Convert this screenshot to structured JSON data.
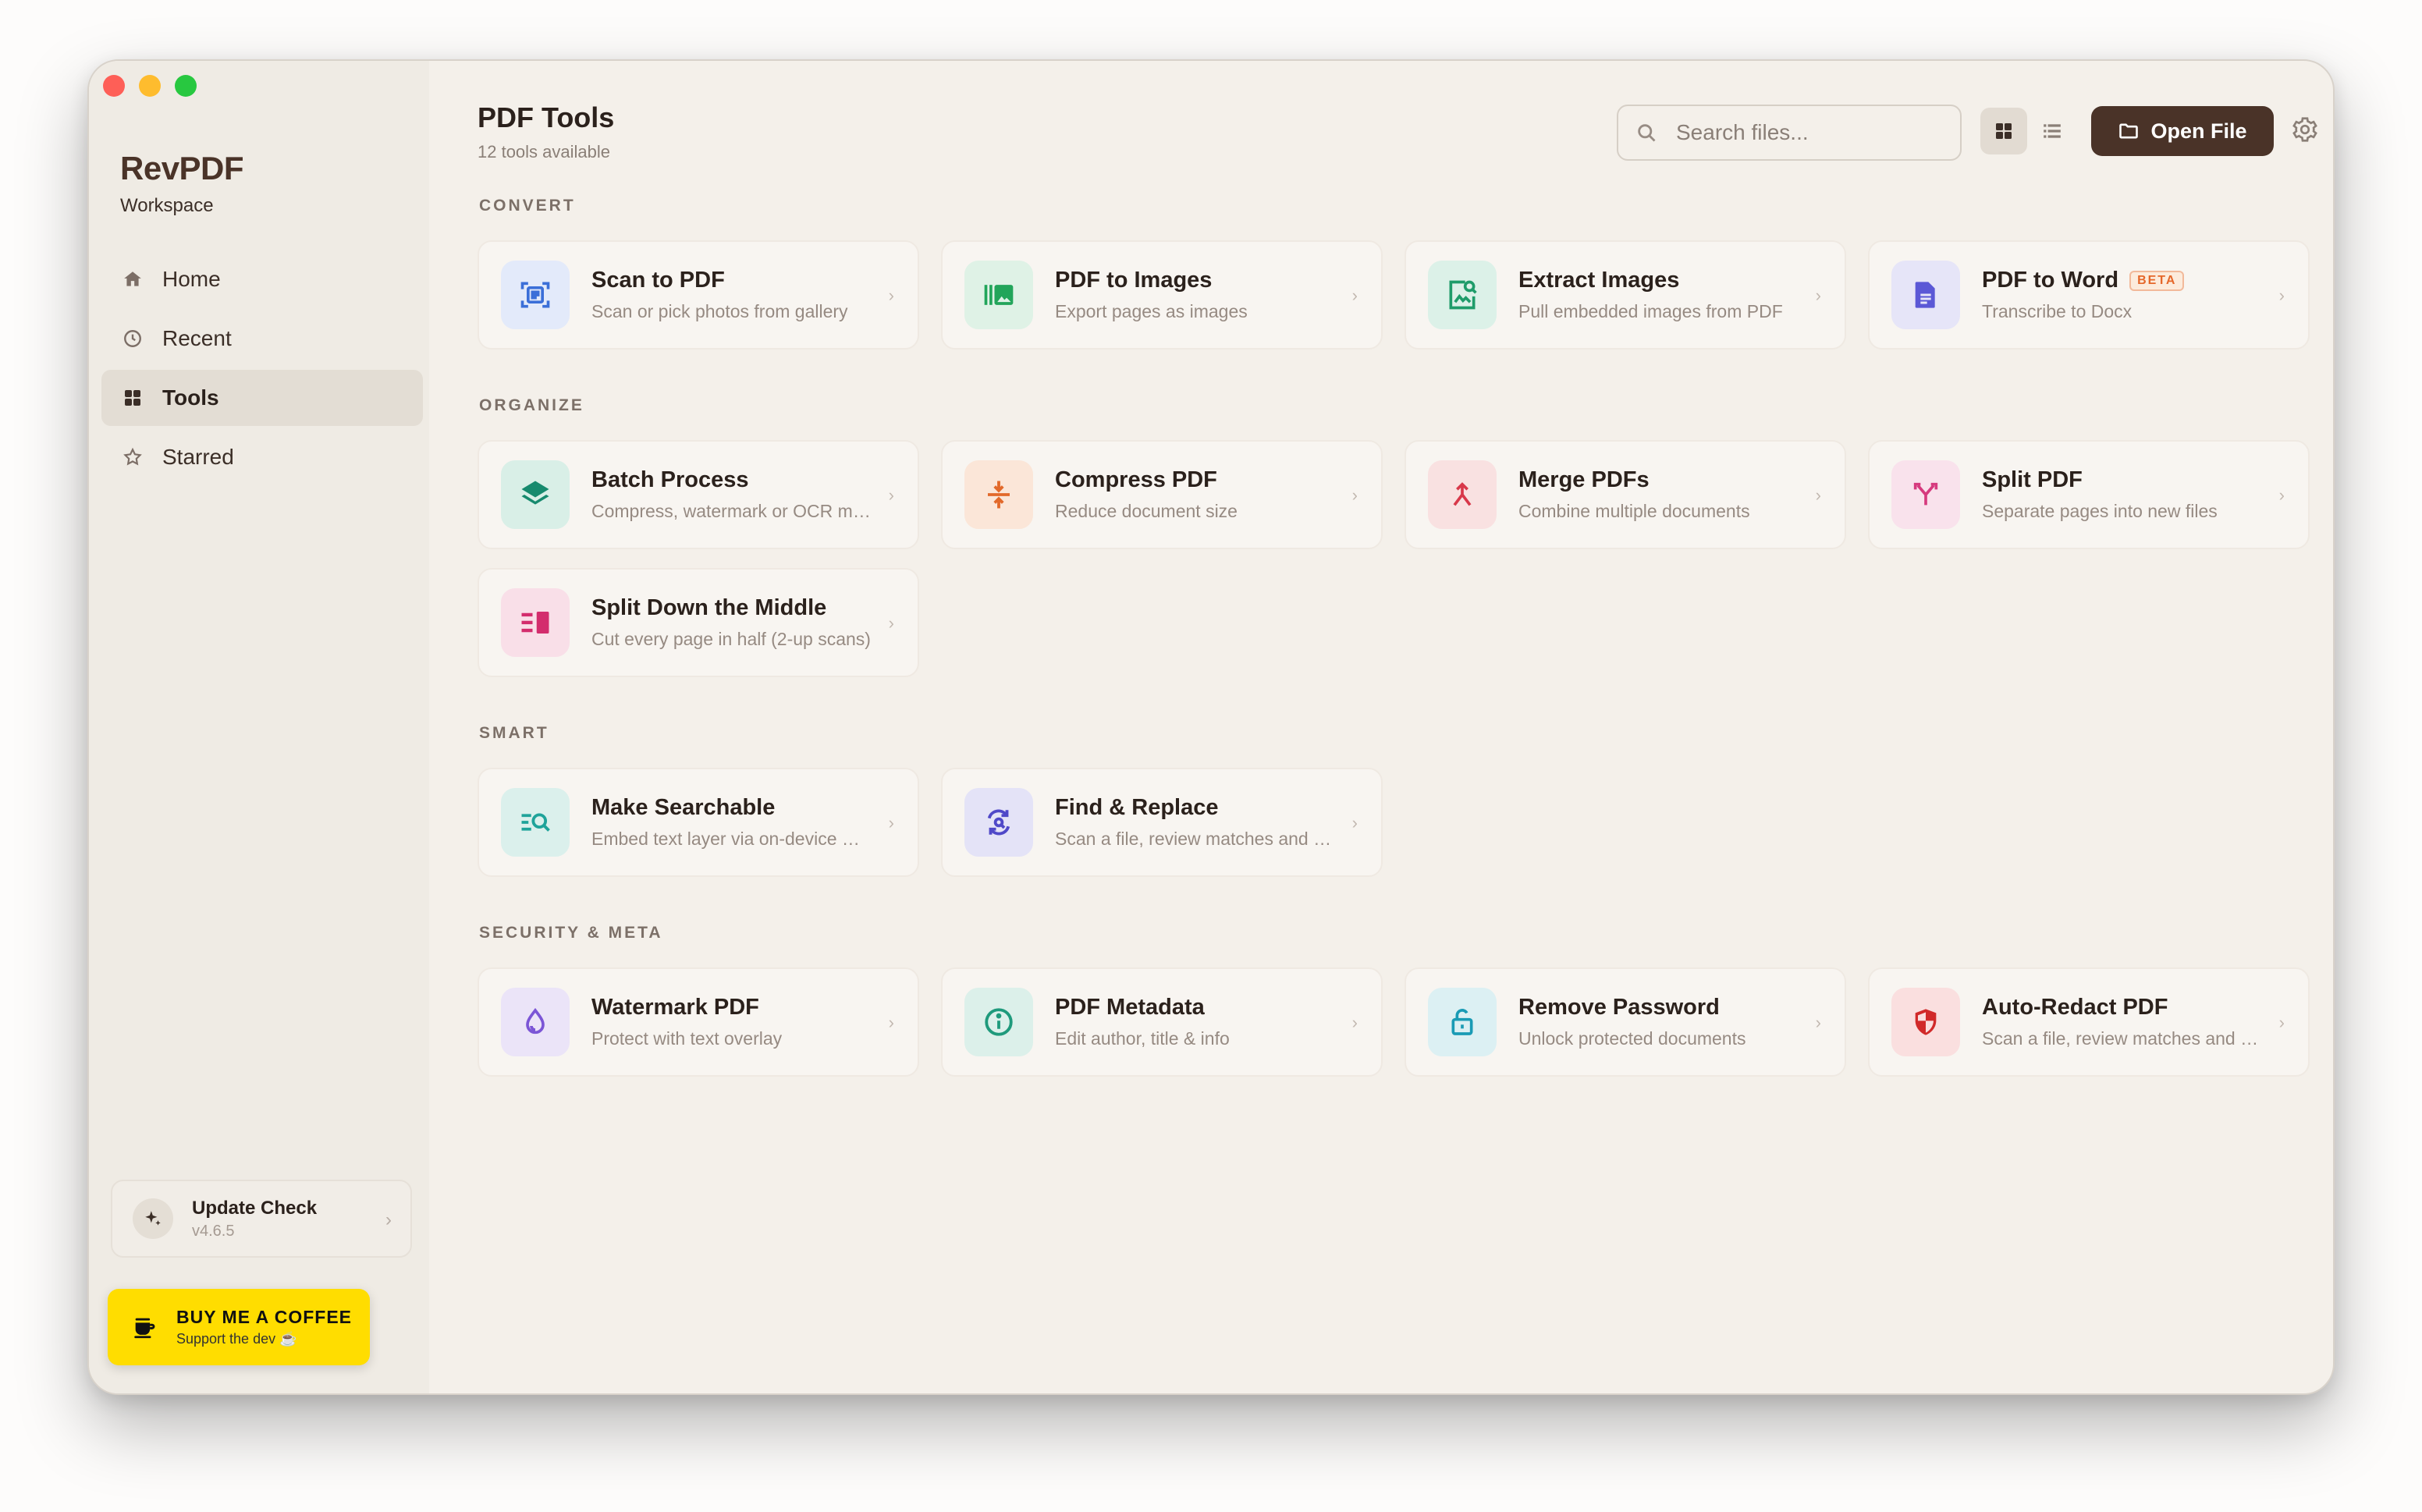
{
  "app": {
    "name": "RevPDF",
    "subtitle": "Workspace"
  },
  "sidebar": {
    "items": [
      {
        "label": "Home",
        "icon": "home-icon",
        "active": false
      },
      {
        "label": "Recent",
        "icon": "clock-icon",
        "active": false
      },
      {
        "label": "Tools",
        "icon": "grid-icon",
        "active": true
      },
      {
        "label": "Starred",
        "icon": "star-icon",
        "active": false
      }
    ],
    "update": {
      "title": "Update Check",
      "version": "v4.6.5"
    },
    "coffee": {
      "title": "BUY ME A COFFEE",
      "subtitle": "Support the dev ☕"
    }
  },
  "header": {
    "title": "PDF Tools",
    "subtitle": "12 tools available",
    "search_placeholder": "Search files...",
    "open_label": "Open File"
  },
  "sections": [
    {
      "label": "CONVERT"
    },
    {
      "label": "ORGANIZE"
    },
    {
      "label": "SMART"
    },
    {
      "label": "SECURITY & META"
    }
  ],
  "tools": [
    {
      "title": "Scan to PDF",
      "desc": "Scan or pick photos from gallery",
      "icon": "scan-icon",
      "color": "#3b6fd8",
      "bg": "#e3eafa"
    },
    {
      "title": "PDF to Images",
      "desc": "Export pages as images",
      "icon": "images-icon",
      "color": "#22a55a",
      "bg": "#dff2e6"
    },
    {
      "title": "Extract Images",
      "desc": "Pull embedded images from PDF",
      "icon": "extract-image-icon",
      "color": "#1f9c6a",
      "bg": "#dcf1e8"
    },
    {
      "title": "PDF to Word",
      "desc": "Transcribe to Docx",
      "icon": "document-icon",
      "color": "#5b58d6",
      "bg": "#e6e5f8",
      "badge": "BETA"
    },
    {
      "title": "Batch Process",
      "desc": "Compress, watermark or OCR many files",
      "icon": "layers-icon",
      "color": "#178a6e",
      "bg": "#d9efe7"
    },
    {
      "title": "Compress PDF",
      "desc": "Reduce document size",
      "icon": "compress-icon",
      "color": "#e2692a",
      "bg": "#fbe6d8"
    },
    {
      "title": "Merge PDFs",
      "desc": "Combine multiple documents",
      "icon": "merge-icon",
      "color": "#d8384a",
      "bg": "#f9e1e1"
    },
    {
      "title": "Split PDF",
      "desc": "Separate pages into new files",
      "icon": "split-icon",
      "color": "#d63a7e",
      "bg": "#f9e2ec"
    },
    {
      "title": "Split Down the Middle",
      "desc": "Cut every page in half (2-up scans)",
      "icon": "split-middle-icon",
      "color": "#d32d6d",
      "bg": "#f9dfe8"
    },
    {
      "title": "Make Searchable",
      "desc": "Embed text layer via on-device OCR",
      "icon": "search-text-icon",
      "color": "#1fa39a",
      "bg": "#dbf0ec"
    },
    {
      "title": "Find & Replace",
      "desc": "Scan a file, review matches and replace",
      "icon": "find-replace-icon",
      "color": "#4f48c8",
      "bg": "#e4e3f7"
    },
    {
      "title": "Watermark PDF",
      "desc": "Protect with text overlay",
      "icon": "droplet-icon",
      "color": "#7b55d6",
      "bg": "#ebe4f8"
    },
    {
      "title": "PDF Metadata",
      "desc": "Edit author, title & info",
      "icon": "info-icon",
      "color": "#1f9a7c",
      "bg": "#dcf0ea"
    },
    {
      "title": "Remove Password",
      "desc": "Unlock protected documents",
      "icon": "unlock-icon",
      "color": "#1a9bb5",
      "bg": "#dcf0f3"
    },
    {
      "title": "Auto-Redact PDF",
      "desc": "Scan a file, review matches and redact",
      "icon": "shield-icon",
      "color": "#d12a2a",
      "bg": "#fadfdf"
    }
  ]
}
